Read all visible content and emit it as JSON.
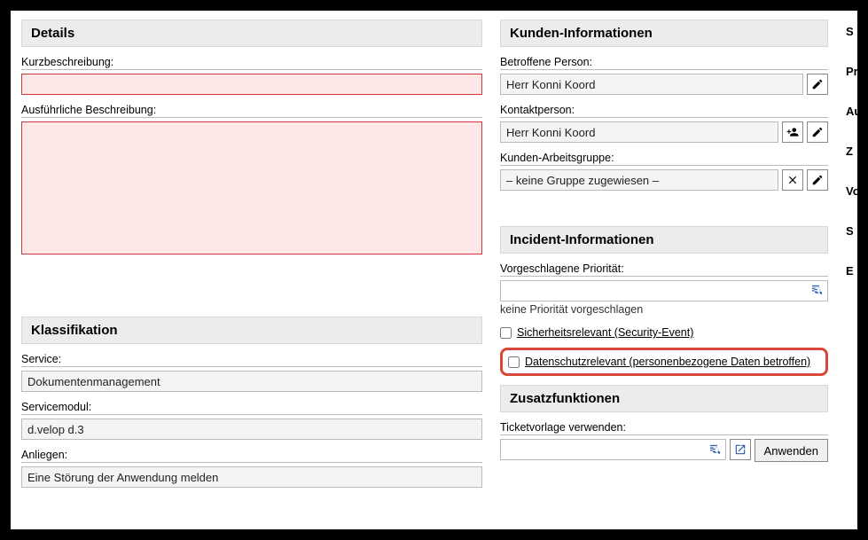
{
  "left": {
    "details_header": "Details",
    "kurzbeschreibung_label": "Kurzbeschreibung:",
    "kurzbeschreibung_value": "",
    "ausfuehrlich_label": "Ausführliche Beschreibung:",
    "ausfuehrlich_value": "",
    "klassifikation_header": "Klassifikation",
    "service_label": "Service:",
    "service_value": "Dokumentenmanagement",
    "servicemodul_label": "Servicemodul:",
    "servicemodul_value": "d.velop d.3",
    "anliegen_label": "Anliegen:",
    "anliegen_value": "Eine Störung der Anwendung melden"
  },
  "right": {
    "kunden_header": "Kunden-Informationen",
    "betroffene_label": "Betroffene Person:",
    "betroffene_value": "Herr Konni Koord",
    "kontakt_label": "Kontaktperson:",
    "kontakt_value": "Herr Konni Koord",
    "arbeitsgruppe_label": "Kunden-Arbeitsgruppe:",
    "arbeitsgruppe_value": "– keine Gruppe zugewiesen –",
    "incident_header": "Incident-Informationen",
    "prio_label": "Vorgeschlagene Priorität:",
    "prio_value": "",
    "prio_hint": "keine Priorität vorgeschlagen",
    "sicherheit_label": "Sicherheitsrelevant (Security-Event)",
    "datenschutz_label": "Datenschutzrelevant (personenbezogene Daten betroffen)",
    "zusatz_header": "Zusatzfunktionen",
    "vorlage_label": "Ticketvorlage verwenden:",
    "vorlage_value": "",
    "anwenden_label": "Anwenden"
  },
  "cut": {
    "a": "S",
    "b": "Pr",
    "c": "Au",
    "d": "Z",
    "e": "Vo",
    "f": "S",
    "g": "E"
  }
}
